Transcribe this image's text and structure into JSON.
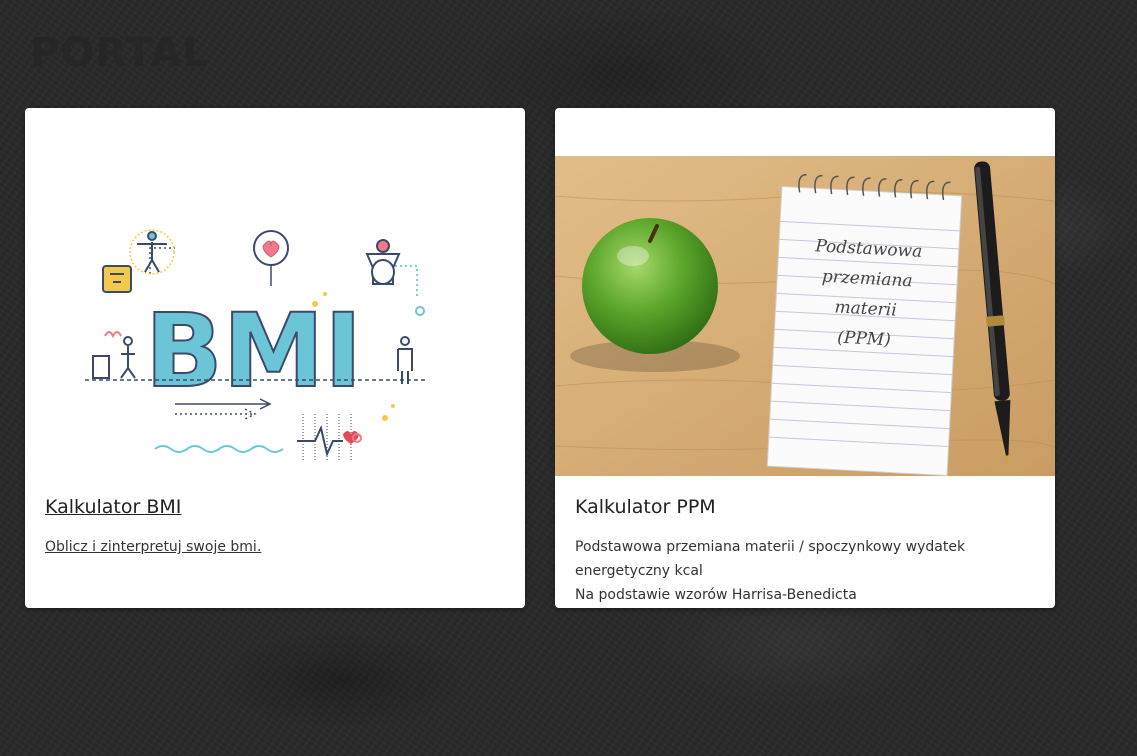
{
  "page": {
    "ghost_heading": "PORTAL"
  },
  "cards": [
    {
      "title": "Kalkulator BMI",
      "description": "Oblicz i zinterpretuj swoje bmi.",
      "image_text": "BMI"
    },
    {
      "title": "Kalkulator PPM",
      "description_line1": "Podstawowa przemiana materii / spoczynkowy wydatek energetyczny kcal",
      "description_line2": "Na podstawie wzorów Harrisa-Benedicta",
      "notepad_lines": [
        "Podstawowa",
        "przemiana",
        "materii",
        "(PPM)"
      ]
    }
  ],
  "colors": {
    "bmi_letters": "#6cc5d6",
    "apple_green": "#5aa52a",
    "wood": "#d9b07a"
  }
}
